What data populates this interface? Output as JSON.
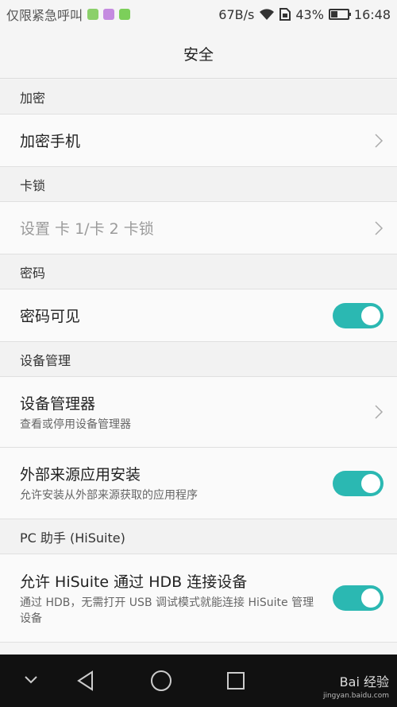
{
  "status_bar": {
    "carrier_text": "仅限紧急呼叫",
    "net_speed": "67B/s",
    "battery_percent": "43%",
    "time": "16:48",
    "battery_level": 0.43
  },
  "header": {
    "title": "安全"
  },
  "sections": {
    "encryption": "加密",
    "sim_lock": "卡锁",
    "password": "密码",
    "device_mgmt": "设备管理",
    "pc_assistant": "PC 助手 (HiSuite)"
  },
  "items": {
    "encrypt_phone": {
      "title": "加密手机"
    },
    "sim_lock_setup": {
      "title": "设置 卡 1/卡 2 卡锁"
    },
    "password_visible": {
      "title": "密码可见",
      "enabled": true
    },
    "device_managers": {
      "title": "设备管理器",
      "subtitle": "查看或停用设备管理器"
    },
    "unknown_sources": {
      "title": "外部来源应用安装",
      "subtitle": "允许安装从外部来源获取的应用程序",
      "enabled": true
    },
    "hisuite_hdb": {
      "title": "允许 HiSuite 通过 HDB 连接设备",
      "subtitle": "通过 HDB，无需打开 USB 调试模式就能连接 HiSuite 管理设备",
      "enabled": true
    }
  },
  "watermark": {
    "brand": "Bai 经验",
    "url": "jingyan.baidu.com"
  },
  "colors": {
    "accent": "#2bb8b2",
    "navbar": "#111111"
  }
}
